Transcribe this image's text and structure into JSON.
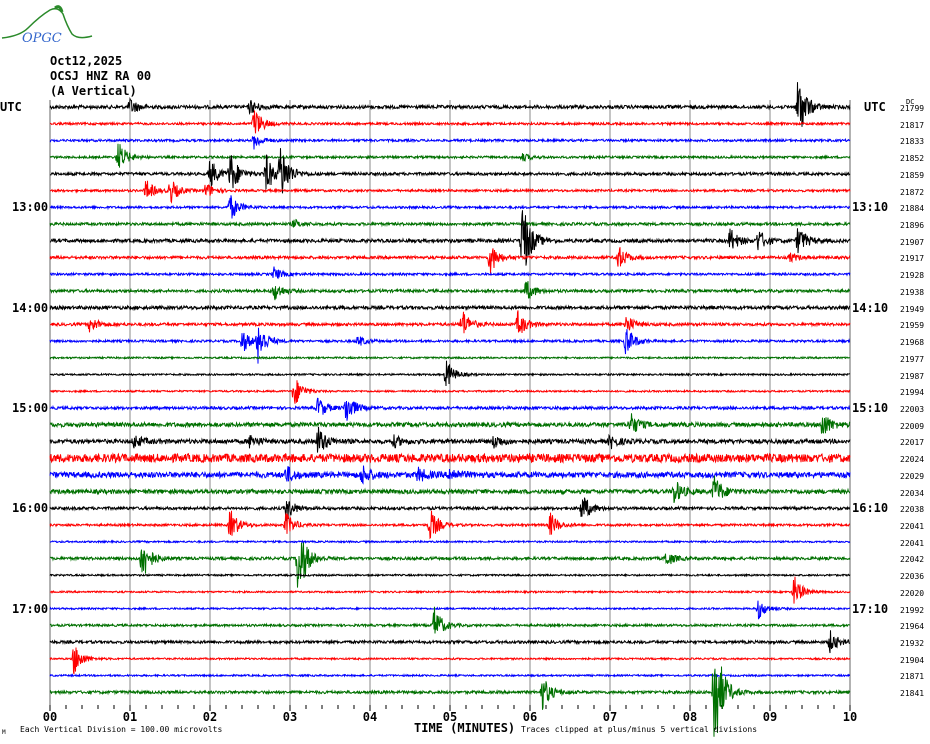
{
  "logo": {
    "text": "OPGC"
  },
  "header": {
    "date": "Oct12,2025",
    "station": "OCSJ HNZ RA 00",
    "component": "(A Vertical)"
  },
  "left_timezone": "UTC",
  "right_timezone": "UTC",
  "dc_label": "DC",
  "footer": {
    "scale": "Each Vertical Division =  100.00 microvolts",
    "clip": "Traces clipped at plus/minus 5 vertical divisions",
    "corner": "M"
  },
  "colors": {
    "cycle": [
      "#000000",
      "#ff0000",
      "#0000ff",
      "#007000"
    ],
    "grid": "#888888"
  },
  "chart_data": {
    "type": "line",
    "title": "OCSJ HNZ RA 00 (A Vertical) Oct12,2025",
    "xlabel": "TIME (MINUTES)",
    "xlim": [
      0,
      10
    ],
    "x_ticks": [
      "00",
      "01",
      "02",
      "03",
      "04",
      "05",
      "06",
      "07",
      "08",
      "09",
      "10"
    ],
    "left_hour_labels": [
      {
        "trace": 6,
        "label": "13:00"
      },
      {
        "trace": 12,
        "label": "14:00"
      },
      {
        "trace": 18,
        "label": "15:00"
      },
      {
        "trace": 24,
        "label": "16:00"
      },
      {
        "trace": 30,
        "label": "17:00"
      }
    ],
    "right_hour_labels": [
      {
        "trace": 6,
        "label": "13:10"
      },
      {
        "trace": 12,
        "label": "14:10"
      },
      {
        "trace": 18,
        "label": "15:10"
      },
      {
        "trace": 24,
        "label": "16:10"
      },
      {
        "trace": 30,
        "label": "17:10"
      }
    ],
    "dc_offsets": [
      21799,
      21817,
      21833,
      21852,
      21859,
      21872,
      21884,
      21896,
      21907,
      21917,
      21928,
      21938,
      21949,
      21959,
      21968,
      21977,
      21987,
      21994,
      22003,
      22009,
      22017,
      22024,
      22029,
      22034,
      22038,
      22041,
      22041,
      22042,
      22036,
      22020,
      21992,
      21964,
      21932,
      21904,
      21871,
      21841
    ],
    "noise_divisions": [
      0.12,
      0.08,
      0.08,
      0.08,
      0.1,
      0.08,
      0.08,
      0.1,
      0.12,
      0.1,
      0.08,
      0.1,
      0.12,
      0.1,
      0.08,
      0.06,
      0.06,
      0.06,
      0.1,
      0.15,
      0.15,
      0.3,
      0.2,
      0.15,
      0.1,
      0.08,
      0.06,
      0.1,
      0.06,
      0.06,
      0.06,
      0.08,
      0.1,
      0.06,
      0.06,
      0.1
    ],
    "clip_divisions": 5,
    "events": [
      {
        "trace": 0,
        "minute": 1.0,
        "amp": 0.6
      },
      {
        "trace": 0,
        "minute": 2.5,
        "amp": 0.5
      },
      {
        "trace": 0,
        "minute": 9.35,
        "amp": 2.5
      },
      {
        "trace": 1,
        "minute": 2.55,
        "amp": 1.2
      },
      {
        "trace": 2,
        "minute": 2.55,
        "amp": 0.6
      },
      {
        "trace": 3,
        "minute": 0.85,
        "amp": 1.2
      },
      {
        "trace": 3,
        "minute": 5.9,
        "amp": 0.3
      },
      {
        "trace": 4,
        "minute": 2.0,
        "amp": 1.1
      },
      {
        "trace": 4,
        "minute": 2.25,
        "amp": 1.6
      },
      {
        "trace": 4,
        "minute": 2.7,
        "amp": 1.4
      },
      {
        "trace": 4,
        "minute": 2.88,
        "amp": 2.2
      },
      {
        "trace": 5,
        "minute": 1.2,
        "amp": 0.8
      },
      {
        "trace": 5,
        "minute": 1.5,
        "amp": 0.9
      },
      {
        "trace": 5,
        "minute": 1.95,
        "amp": 0.6
      },
      {
        "trace": 6,
        "minute": 2.25,
        "amp": 1.0
      },
      {
        "trace": 7,
        "minute": 3.05,
        "amp": 0.3
      },
      {
        "trace": 8,
        "minute": 5.9,
        "amp": 3.2
      },
      {
        "trace": 8,
        "minute": 8.5,
        "amp": 0.9
      },
      {
        "trace": 8,
        "minute": 8.85,
        "amp": 0.8
      },
      {
        "trace": 8,
        "minute": 9.35,
        "amp": 1.1
      },
      {
        "trace": 9,
        "minute": 5.5,
        "amp": 1.2
      },
      {
        "trace": 9,
        "minute": 7.1,
        "amp": 0.9
      },
      {
        "trace": 9,
        "minute": 9.25,
        "amp": 0.3
      },
      {
        "trace": 10,
        "minute": 2.8,
        "amp": 0.5
      },
      {
        "trace": 11,
        "minute": 2.8,
        "amp": 0.7
      },
      {
        "trace": 11,
        "minute": 5.95,
        "amp": 0.8
      },
      {
        "trace": 13,
        "minute": 0.5,
        "amp": 0.6
      },
      {
        "trace": 13,
        "minute": 5.15,
        "amp": 1.1
      },
      {
        "trace": 13,
        "minute": 5.85,
        "amp": 1.0
      },
      {
        "trace": 13,
        "minute": 7.2,
        "amp": 0.7
      },
      {
        "trace": 14,
        "minute": 2.4,
        "amp": 0.9
      },
      {
        "trace": 14,
        "minute": 2.6,
        "amp": 1.5
      },
      {
        "trace": 14,
        "minute": 3.85,
        "amp": 0.4
      },
      {
        "trace": 14,
        "minute": 7.2,
        "amp": 1.1
      },
      {
        "trace": 16,
        "minute": 4.95,
        "amp": 1.1
      },
      {
        "trace": 17,
        "minute": 3.05,
        "amp": 1.2
      },
      {
        "trace": 18,
        "minute": 3.35,
        "amp": 0.8
      },
      {
        "trace": 18,
        "minute": 3.7,
        "amp": 1.2
      },
      {
        "trace": 19,
        "minute": 7.25,
        "amp": 0.9
      },
      {
        "trace": 19,
        "minute": 9.65,
        "amp": 1.0
      },
      {
        "trace": 20,
        "minute": 1.05,
        "amp": 0.5
      },
      {
        "trace": 20,
        "minute": 2.5,
        "amp": 0.5
      },
      {
        "trace": 20,
        "minute": 3.35,
        "amp": 1.1
      },
      {
        "trace": 20,
        "minute": 4.3,
        "amp": 0.4
      },
      {
        "trace": 20,
        "minute": 5.55,
        "amp": 0.5
      },
      {
        "trace": 20,
        "minute": 7.0,
        "amp": 0.5
      },
      {
        "trace": 22,
        "minute": 2.95,
        "amp": 0.6
      },
      {
        "trace": 22,
        "minute": 3.9,
        "amp": 0.7
      },
      {
        "trace": 22,
        "minute": 4.6,
        "amp": 0.5
      },
      {
        "trace": 22,
        "minute": 5.0,
        "amp": 0.5
      },
      {
        "trace": 23,
        "minute": 7.8,
        "amp": 0.9
      },
      {
        "trace": 23,
        "minute": 8.3,
        "amp": 1.2
      },
      {
        "trace": 24,
        "minute": 2.95,
        "amp": 0.9
      },
      {
        "trace": 24,
        "minute": 6.65,
        "amp": 1.1
      },
      {
        "trace": 25,
        "minute": 2.25,
        "amp": 1.2
      },
      {
        "trace": 25,
        "minute": 2.95,
        "amp": 0.9
      },
      {
        "trace": 25,
        "minute": 4.75,
        "amp": 1.2
      },
      {
        "trace": 25,
        "minute": 6.25,
        "amp": 0.9
      },
      {
        "trace": 27,
        "minute": 1.15,
        "amp": 1.8
      },
      {
        "trace": 27,
        "minute": 3.1,
        "amp": 3.0
      },
      {
        "trace": 27,
        "minute": 7.7,
        "amp": 0.6
      },
      {
        "trace": 29,
        "minute": 9.3,
        "amp": 1.2
      },
      {
        "trace": 30,
        "minute": 8.85,
        "amp": 0.8
      },
      {
        "trace": 31,
        "minute": 4.8,
        "amp": 1.4
      },
      {
        "trace": 32,
        "minute": 9.75,
        "amp": 0.8
      },
      {
        "trace": 33,
        "minute": 0.3,
        "amp": 1.2
      },
      {
        "trace": 35,
        "minute": 6.15,
        "amp": 1.3
      },
      {
        "trace": 35,
        "minute": 8.3,
        "amp": 5.0
      }
    ]
  }
}
